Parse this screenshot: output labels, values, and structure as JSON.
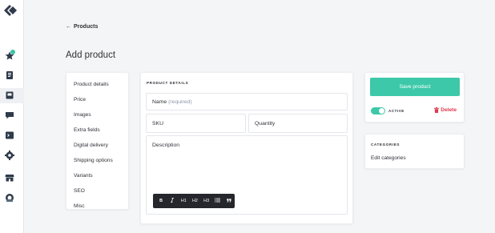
{
  "back_link": {
    "arrow": "←",
    "label": "Products"
  },
  "page_title": "Add product",
  "sidenav": {
    "items": [
      "Product details",
      "Price",
      "Images",
      "Extra fields",
      "Digital delivery",
      "Shipping options",
      "Variants",
      "SEO",
      "Misc"
    ]
  },
  "form": {
    "section_title": "PRODUCT DETAILS",
    "name_label": "Name",
    "name_hint": "(required)",
    "sku_label": "SKU",
    "quantity_label": "Quantity",
    "description_label": "Description",
    "toolbar": [
      "B",
      "I",
      "H1",
      "H2",
      "H3",
      "list",
      "quote"
    ]
  },
  "actions": {
    "save_label": "Save product",
    "active_label": "ACTIVE",
    "active_on": true,
    "delete_label": "Delete"
  },
  "categories": {
    "section_title": "CATEGORIES",
    "edit_label": "Edit categories"
  },
  "colors": {
    "accent": "#3dc9a9",
    "danger": "#e0384f",
    "background": "#f4f5f7",
    "toolbar_bg": "#25272c"
  },
  "rail_icons": [
    "logo-icon",
    "star-icon",
    "document-icon",
    "inbox-icon",
    "chat-icon",
    "terminal-icon",
    "gear-icon",
    "store-icon",
    "support-icon"
  ]
}
